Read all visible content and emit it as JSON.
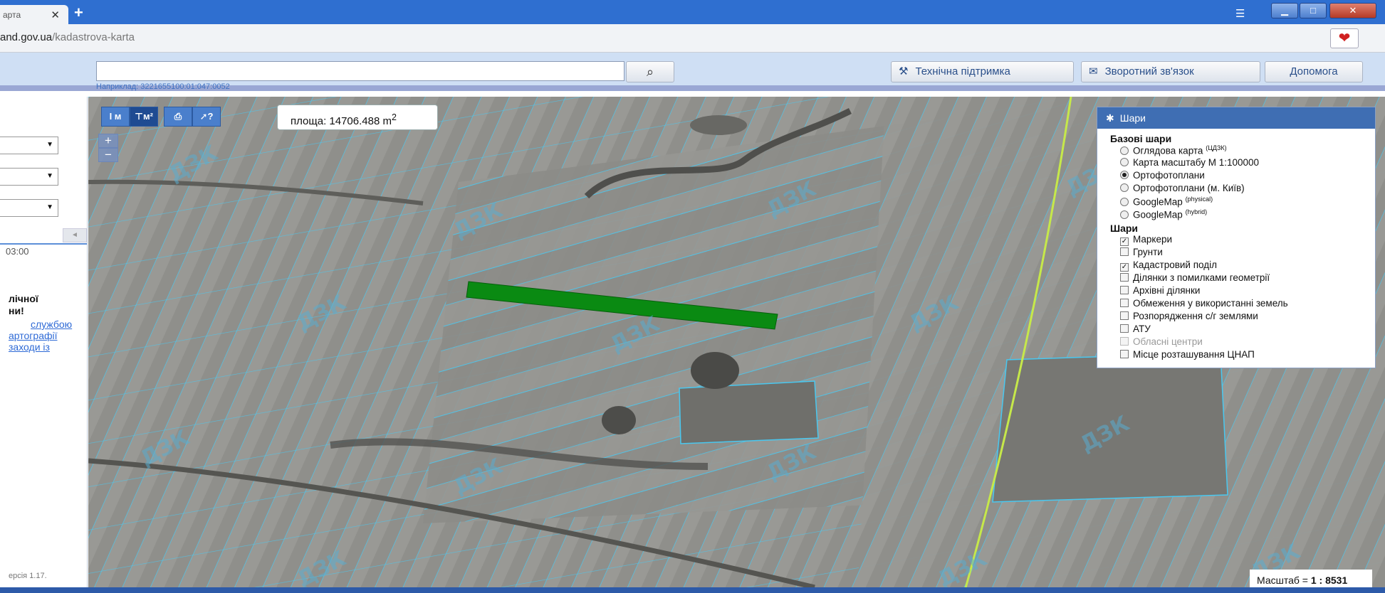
{
  "browser": {
    "tab_title": "арта",
    "tab_close": "✕",
    "new_tab": "+",
    "url_host": "and.gov.ua",
    "url_path": "/kadastrova-karta",
    "menu_icon": "menu-icon",
    "minimize": "▁",
    "maximize": "□",
    "close": "✕",
    "heart_icon": "❤"
  },
  "header": {
    "search_value": "",
    "search_hint": "Наприклад: 3221655100:01:047:0052",
    "search_icon": "🔍",
    "buttons": [
      {
        "icon": "⚒",
        "label": "Технічна підтримка"
      },
      {
        "icon": "✉",
        "label": "Зворотний зв'язок"
      },
      {
        "icon": "",
        "label": "Допомога"
      }
    ]
  },
  "left_panel": {
    "collapse": "◄",
    "time": "03:00",
    "notice_line1": "лічної",
    "notice_line2": "ни!",
    "links": [
      "службою",
      "артографії",
      "заходи  із"
    ],
    "version": "ерсія 1.17."
  },
  "map": {
    "toolbar": [
      {
        "label": "I м",
        "active": false
      },
      {
        "label": "⊤м²",
        "active": true
      },
      {
        "label": "⎙",
        "active": false
      },
      {
        "label": "➚?",
        "active": false
      }
    ],
    "area_label": "площа: 14706.488 m",
    "area_sup": "2",
    "zoom_in": "+",
    "zoom_out": "−",
    "scale_label": "Масштаб = ",
    "scale_value": "1 : 8531",
    "parcel_color": "#0a8a12",
    "boundary_color": "#49c8f0",
    "watermark": "ДЗК"
  },
  "layers": {
    "title": "Шари",
    "base_title": "Базові шари",
    "base": [
      {
        "label": "Оглядова карта",
        "sup": "(ЦДЗК)",
        "on": false
      },
      {
        "label": "Карта масштабу М 1:100000",
        "sup": "",
        "on": false
      },
      {
        "label": "Ортофотоплани",
        "sup": "",
        "on": true
      },
      {
        "label": "Ортофотоплани (м. Київ)",
        "sup": "",
        "on": false
      },
      {
        "label": "GoogleMap",
        "sup": "(physical)",
        "on": false
      },
      {
        "label": "GoogleMap",
        "sup": "(hybrid)",
        "on": false
      }
    ],
    "overlay_title": "Шари",
    "overlays": [
      {
        "label": "Маркери",
        "checked": true,
        "disabled": false
      },
      {
        "label": "Грунти",
        "checked": false,
        "disabled": false
      },
      {
        "label": "Кадастровий поділ",
        "checked": true,
        "disabled": false
      },
      {
        "label": "Ділянки з помилками геометрії",
        "checked": false,
        "disabled": false
      },
      {
        "label": "Архівні ділянки",
        "checked": false,
        "disabled": false
      },
      {
        "label": "Обмеження у використанні земель",
        "checked": false,
        "disabled": false
      },
      {
        "label": "Розпорядження с/г землями",
        "checked": false,
        "disabled": false
      },
      {
        "label": "АТУ",
        "checked": false,
        "disabled": false
      },
      {
        "label": "Обласні центри",
        "checked": false,
        "disabled": true
      },
      {
        "label": "Місце розташування ЦНАП",
        "checked": false,
        "disabled": false
      }
    ]
  }
}
